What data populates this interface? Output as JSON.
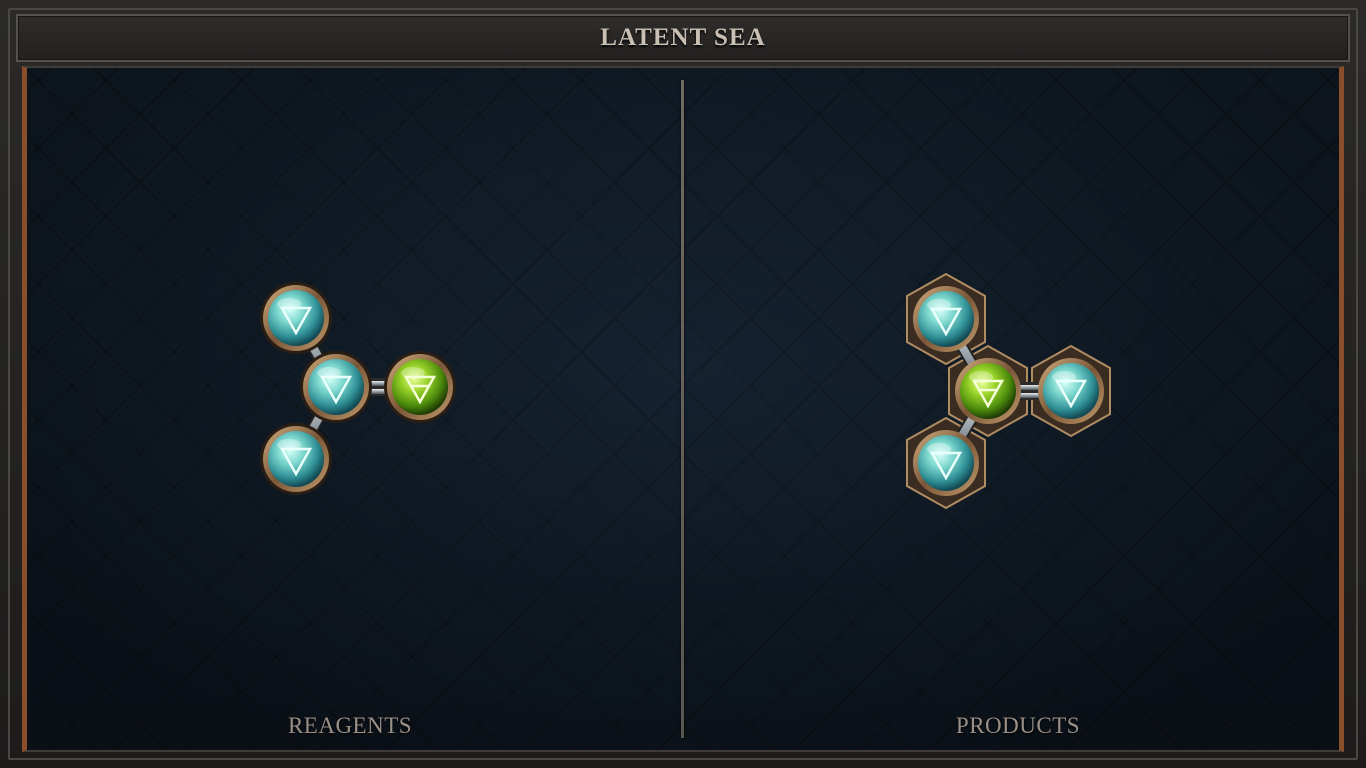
{
  "title": "LATENT SEA",
  "panels": {
    "left_label": "REAGENTS",
    "right_label": "PRODUCTS"
  },
  "colors": {
    "water_atom": "#5ec9c2",
    "earth_atom": "#7cc21e",
    "bronze_ring": "#a07a52",
    "board_bg": "#14202c",
    "frame_accent": "#8a4f2a"
  },
  "molecules": {
    "reagent": {
      "atoms": [
        {
          "element": "water",
          "symbol": "water-symbol-icon"
        },
        {
          "element": "water",
          "symbol": "water-symbol-icon"
        },
        {
          "element": "earth",
          "symbol": "earth-symbol-icon"
        },
        {
          "element": "water",
          "symbol": "water-symbol-icon"
        }
      ]
    },
    "product": {
      "atoms": [
        {
          "element": "water",
          "symbol": "water-symbol-icon"
        },
        {
          "element": "earth",
          "symbol": "earth-symbol-icon"
        },
        {
          "element": "water",
          "symbol": "water-symbol-icon"
        },
        {
          "element": "water",
          "symbol": "water-symbol-icon"
        }
      ]
    }
  }
}
